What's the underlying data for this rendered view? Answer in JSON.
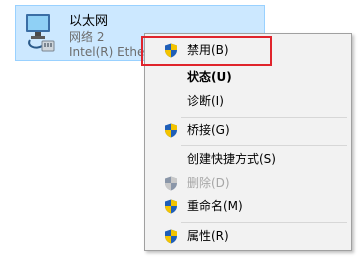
{
  "adapter": {
    "name": "以太网",
    "network": "网络 2",
    "device": "Intel(R) Ethern"
  },
  "context_menu": {
    "items": [
      {
        "label": "禁用(B)",
        "icon": "uac-shield-icon",
        "enabled": true,
        "bold": false
      },
      {
        "label": "状态(U)",
        "icon": null,
        "enabled": true,
        "bold": true
      },
      {
        "label": "诊断(I)",
        "icon": null,
        "enabled": true,
        "bold": false
      },
      {
        "label": "桥接(G)",
        "icon": "uac-shield-icon",
        "enabled": true,
        "bold": false
      },
      {
        "label": "创建快捷方式(S)",
        "icon": null,
        "enabled": true,
        "bold": false
      },
      {
        "label": "删除(D)",
        "icon": "uac-shield-icon",
        "enabled": false,
        "bold": false
      },
      {
        "label": "重命名(M)",
        "icon": "uac-shield-icon",
        "enabled": true,
        "bold": false
      },
      {
        "label": "属性(R)",
        "icon": "uac-shield-icon",
        "enabled": true,
        "bold": false
      }
    ]
  },
  "colors": {
    "selection_bg": "#cce8ff",
    "highlight_border": "#e0242c",
    "disabled_text": "#a6a6a6"
  }
}
